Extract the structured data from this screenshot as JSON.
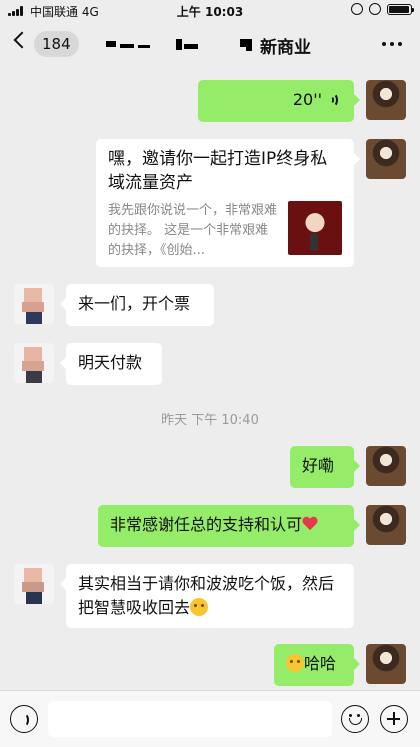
{
  "status": {
    "carrier": "中国联通",
    "network": "4G",
    "time": "上午 10:03",
    "battery_level": 0.95
  },
  "header": {
    "unread_count": "184",
    "title_visible": "新商业"
  },
  "messages": {
    "m1": {
      "duration": "20''"
    },
    "card": {
      "title": "嘿，邀请你一起打造IP终身私域流量资产",
      "desc": "我先跟你说说一个，非常艰难的抉择。 这是一个非常艰难的抉择，《创始..."
    },
    "m3": {
      "text": "来一们，开个票"
    },
    "m4": {
      "text": "明天付款"
    },
    "timestamp": "昨天 下午 10:40",
    "m5": {
      "text": "好嘞"
    },
    "m6": {
      "text": "非常感谢任总的支持和认可"
    },
    "m7": {
      "text": "其实相当于请你和波波吃个饭，然后把智慧吸收回去"
    },
    "m8": {
      "text": "哈哈"
    }
  },
  "icons": {
    "back": "chevron-left-icon",
    "more": "more-dots-icon",
    "voice": "voice-icon",
    "emoji": "emoji-icon",
    "plus": "plus-icon"
  },
  "colors": {
    "background": "#ededed",
    "bubble_green": "#95ec69",
    "bubble_white": "#ffffff",
    "timestamp": "#9a9a9a"
  }
}
